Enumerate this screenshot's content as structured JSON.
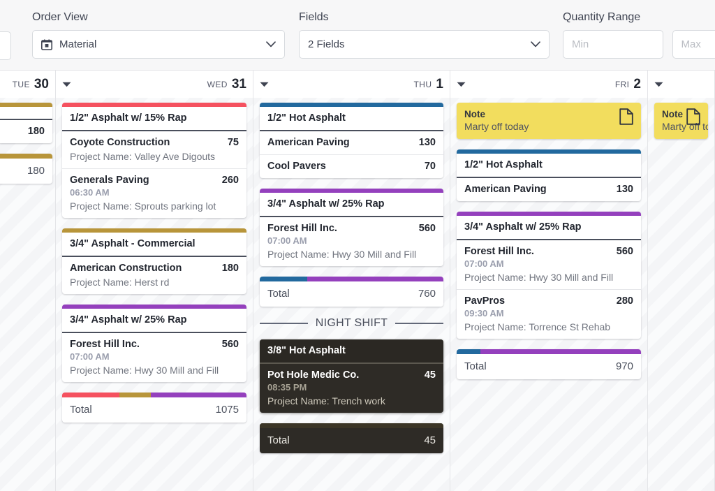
{
  "toolbar": {
    "filters": [
      {
        "label": "Order View",
        "value": "Material",
        "icon": "calendar-icon"
      },
      {
        "label": "Fields",
        "value": "2 Fields"
      }
    ],
    "quantity_range": {
      "label": "Quantity Range",
      "min_placeholder": "Min",
      "max_placeholder": "Max"
    }
  },
  "colors": {
    "red": "#f5515f",
    "gold": "#b8953a",
    "purple": "#9440bd",
    "blue": "#22699e",
    "dark": "#2e2b26",
    "note_yellow": "#f2dd5e"
  },
  "days": [
    {
      "dow": "TUE",
      "daynum": "30",
      "clipped": true,
      "cards": [
        {
          "accent": "#b8953a",
          "title": "",
          "rows": [
            {
              "customer": "",
              "qty": "180"
            }
          ]
        }
      ],
      "total": {
        "label": "",
        "value": "180",
        "segments": [
          {
            "color": "#b8953a",
            "pct": 100
          }
        ]
      }
    },
    {
      "dow": "WED",
      "daynum": "31",
      "cards": [
        {
          "accent": "#f5515f",
          "title": "1/2\" Asphalt w/ 15% Rap",
          "rows": [
            {
              "customer": "Coyote Construction",
              "qty": "75",
              "time": "",
              "project": "Project Name: Valley Ave Digouts"
            },
            {
              "customer": "Generals Paving",
              "qty": "260",
              "time": "06:30 AM",
              "project": "Project Name: Sprouts parking lot"
            }
          ]
        },
        {
          "accent": "#b8953a",
          "title": "3/4\" Asphalt - Commercial",
          "rows": [
            {
              "customer": "American Construction",
              "qty": "180",
              "time": "",
              "project": "Project Name: Herst rd"
            }
          ]
        },
        {
          "accent": "#9440bd",
          "title": "3/4\" Asphalt w/ 25% Rap",
          "rows": [
            {
              "customer": "Forest Hill Inc.",
              "qty": "560",
              "time": "07:00 AM",
              "project": "Project Name: Hwy 30 Mill and Fill"
            }
          ]
        }
      ],
      "total": {
        "label": "Total",
        "value": "1075",
        "segments": [
          {
            "color": "#f5515f",
            "pct": 31
          },
          {
            "color": "#b8953a",
            "pct": 17
          },
          {
            "color": "#9440bd",
            "pct": 52
          }
        ]
      }
    },
    {
      "dow": "THU",
      "daynum": "1",
      "cards": [
        {
          "accent": "#22699e",
          "title": "1/2\" Hot Asphalt",
          "rows": [
            {
              "customer": "American Paving",
              "qty": "130",
              "time": "",
              "project": ""
            },
            {
              "customer": "Cool Pavers",
              "qty": "70",
              "time": "",
              "project": ""
            }
          ]
        },
        {
          "accent": "#9440bd",
          "title": "3/4\" Asphalt w/ 25% Rap",
          "rows": [
            {
              "customer": "Forest Hill Inc.",
              "qty": "560",
              "time": "07:00 AM",
              "project": "Project Name: Hwy 30 Mill and Fill"
            }
          ]
        }
      ],
      "total": {
        "label": "Total",
        "value": "760",
        "segments": [
          {
            "color": "#22699e",
            "pct": 26
          },
          {
            "color": "#9440bd",
            "pct": 74
          }
        ]
      },
      "night_shift": {
        "label": "NIGHT SHIFT",
        "cards": [
          {
            "accent": "",
            "title": "3/8\" Hot Asphalt",
            "rows": [
              {
                "customer": "Pot Hole Medic Co.",
                "qty": "45",
                "time": "08:35 PM",
                "project": "Project Name: Trench work"
              }
            ]
          }
        ],
        "total": {
          "label": "Total",
          "value": "45",
          "segments": [
            {
              "color": "#3b3526",
              "pct": 100
            }
          ]
        }
      }
    },
    {
      "dow": "FRI",
      "daynum": "2",
      "note": {
        "title": "Note",
        "body": "Marty off today",
        "icon": "document-icon"
      },
      "cards": [
        {
          "accent": "#22699e",
          "title": "1/2\" Hot Asphalt",
          "rows": [
            {
              "customer": "American Paving",
              "qty": "130",
              "time": "",
              "project": ""
            }
          ]
        },
        {
          "accent": "#9440bd",
          "title": "3/4\" Asphalt w/ 25% Rap",
          "rows": [
            {
              "customer": "Forest Hill Inc.",
              "qty": "560",
              "time": "07:00 AM",
              "project": "Project Name: Hwy 30 Mill and Fill"
            },
            {
              "customer": "PavPros",
              "qty": "280",
              "time": "09:30 AM",
              "project": "Project Name: Torrence St Rehab"
            }
          ]
        }
      ],
      "total": {
        "label": "Total",
        "value": "970",
        "segments": [
          {
            "color": "#22699e",
            "pct": 13
          },
          {
            "color": "#9440bd",
            "pct": 87
          }
        ]
      }
    },
    {
      "dow": "",
      "daynum": "",
      "clipped_right": true,
      "note": {
        "title": "Note",
        "body": "Marty off today",
        "icon": "document-icon"
      },
      "cards": [],
      "total": null
    }
  ]
}
